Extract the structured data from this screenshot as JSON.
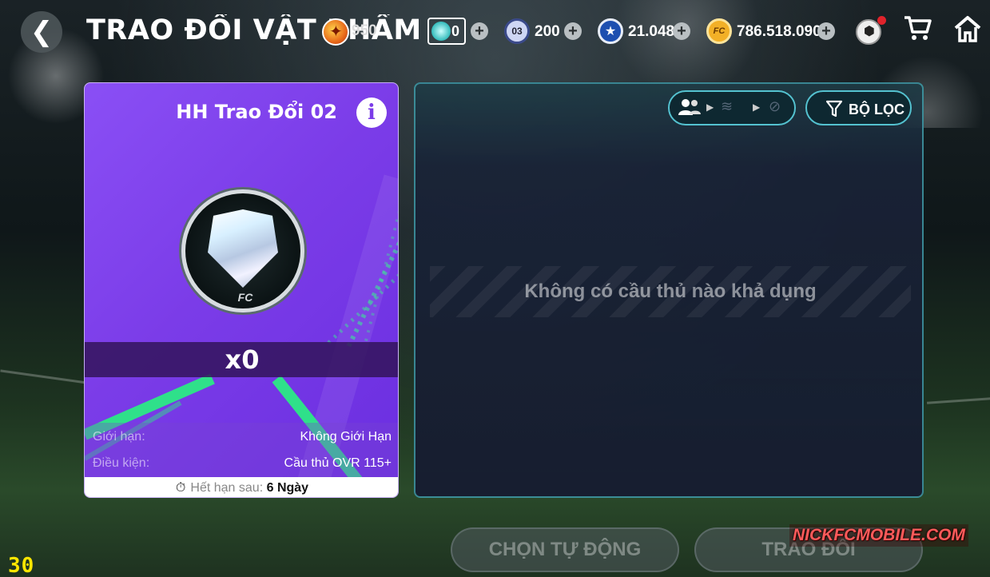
{
  "header": {
    "title": "TRAO ĐỔI VẬT PHẨM",
    "hidden_currency_value": "950",
    "gem_value": "0",
    "currencies": [
      {
        "name": "ticket",
        "icon": "ticket-03-icon",
        "icon_text": "03",
        "value": "200"
      },
      {
        "name": "player-points",
        "icon": "player-icon",
        "icon_text": "★",
        "value": "21.048"
      },
      {
        "name": "fc-coins",
        "icon": "fc-coin-icon",
        "icon_text": "FC",
        "value": "786.518.090"
      }
    ],
    "plus_glyph": "+"
  },
  "card": {
    "title": "HH Trao Đổi 02",
    "info_glyph": "i",
    "quantity": "x0",
    "emblem_text": "FC",
    "limit_label": "Giới hạn:",
    "limit_value": "Không Giới Hạn",
    "condition_label": "Điều kiện:",
    "condition_value": "Cầu thủ OVR 115+",
    "expiry_label": "Hết hạn sau:",
    "expiry_value": "6 Ngày"
  },
  "panel": {
    "filter_label": "BỘ LỌC",
    "empty_message": "Không có cầu thủ nào khả dụng"
  },
  "actions": {
    "auto_select_label": "CHỌN TỰ ĐỘNG",
    "exchange_label": "TRAO ĐỔI"
  },
  "overlay": {
    "watermark": "NICKFCMOBILE.COM",
    "fps": "30"
  },
  "colors": {
    "card_purple": "#7b3ce8",
    "panel_border": "#54c2d0",
    "watermark_red": "#ff5a5a",
    "fps_yellow": "#ffe600"
  }
}
